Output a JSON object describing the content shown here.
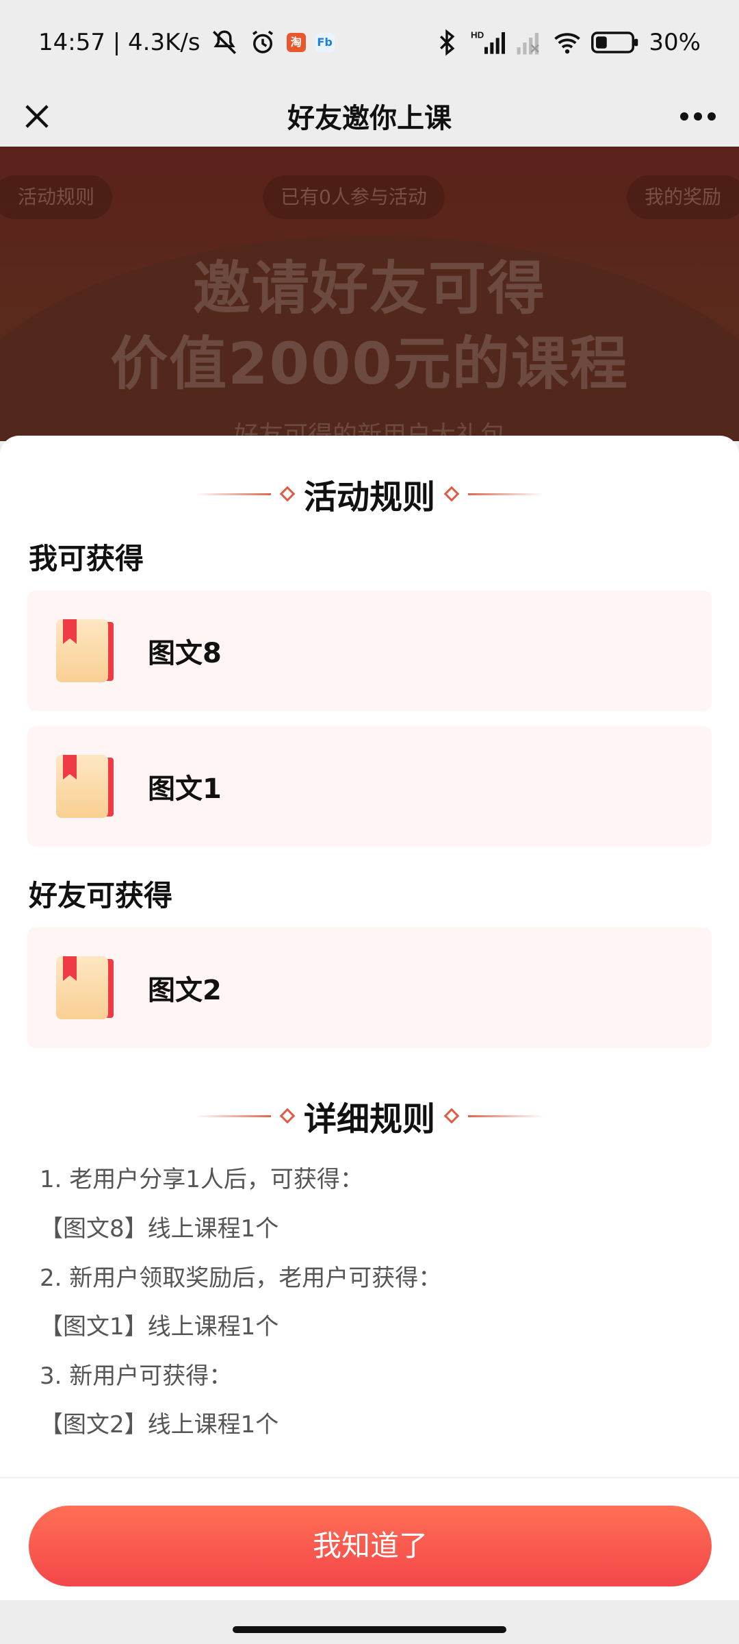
{
  "status_bar": {
    "time_speed": "14:57 | 4.3K/s",
    "battery": "30%",
    "hd_label": "HD",
    "taobao_badge": "淘",
    "fb_badge": "Fb"
  },
  "nav": {
    "title": "好友邀你上课"
  },
  "hero": {
    "rules_pill": "活动规则",
    "participants_pill": "已有0人参与活动",
    "rewards_pill": "我的奖励",
    "title_line1": "邀请好友可得",
    "title_line2": "价值2000元的课程",
    "subtitle": "好友可得的新用户大礼包"
  },
  "sheet": {
    "section1_title": "活动规则",
    "me_group_title": "我可获得",
    "me_items": [
      {
        "label": "图文8"
      },
      {
        "label": "图文1"
      }
    ],
    "friend_group_title": "好友可获得",
    "friend_items": [
      {
        "label": "图文2"
      }
    ],
    "section2_title": "详细规则",
    "rules": [
      "1. 老用户分享1人后，可获得：",
      "【图文8】线上课程1个",
      "2. 新用户领取奖励后，老用户可获得：",
      "【图文1】线上课程1个",
      "3. 新用户可获得：",
      "【图文2】线上课程1个"
    ],
    "ok_button": "我知道了"
  },
  "colors": {
    "accent": "#f4474a",
    "card_bg": "#fff5f4",
    "hero_bg": "#5b221b"
  }
}
